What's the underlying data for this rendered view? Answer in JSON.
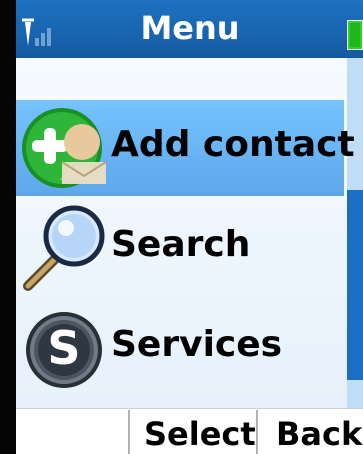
{
  "header": {
    "title": "Menu",
    "signal_icon": "signal-strength-icon",
    "battery_icon": "battery-icon"
  },
  "colors": {
    "header": "#1a66b1",
    "selection": "#64b5f5",
    "background": "#e9f2fb",
    "scrollbar_track": "#c0ddf6",
    "scrollbar_thumb": "#1a6fc4",
    "battery": "#22c51a"
  },
  "menu": {
    "items": [
      {
        "label": "Add contact",
        "icon": "add-contact-icon",
        "selected": true
      },
      {
        "label": "Search",
        "icon": "search-icon",
        "selected": false
      },
      {
        "label": "Services",
        "icon": "skype-icon",
        "selected": false
      }
    ]
  },
  "softkeys": {
    "left_label": "",
    "select_label": "Select",
    "back_label": "Back"
  }
}
